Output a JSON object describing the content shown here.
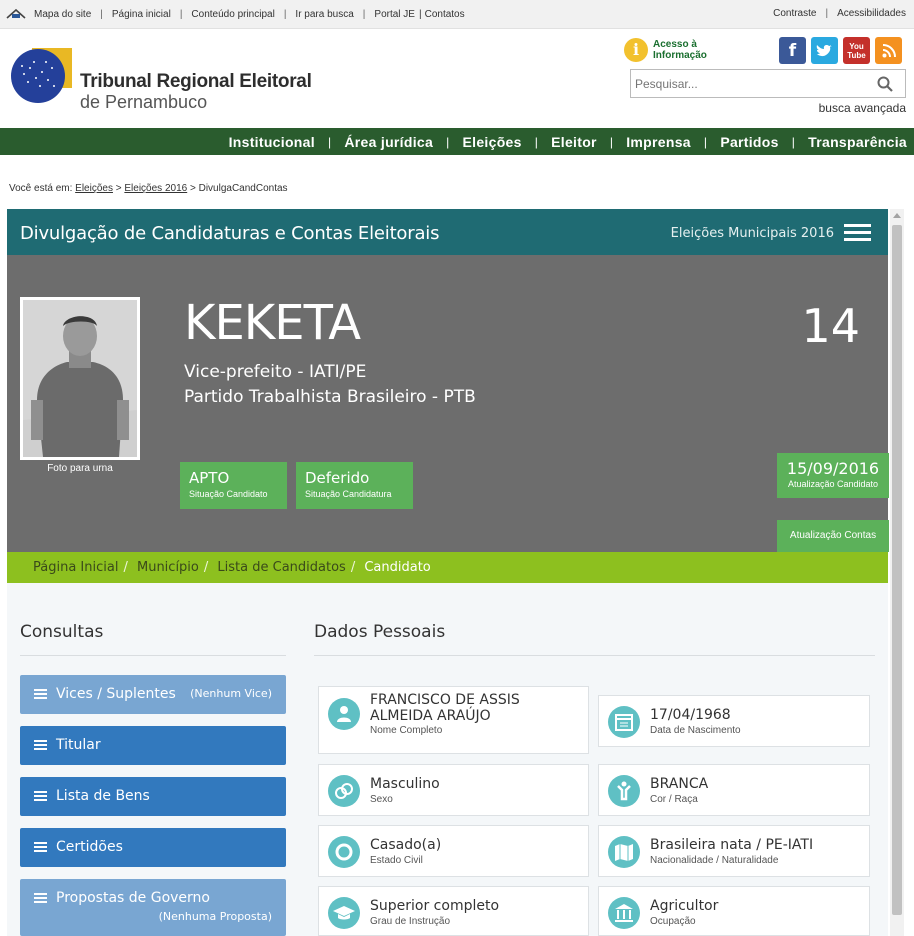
{
  "topbar": {
    "left_links": [
      "Mapa do site",
      "Página inicial",
      "Conteúdo principal",
      "Ir para busca",
      "Portal JE",
      "Contatos"
    ],
    "right_links": [
      "Contraste",
      "Acessibilidades"
    ]
  },
  "header": {
    "org_title": "Tribunal Regional Eleitoral",
    "org_subtitle": "de Pernambuco",
    "acesso_line1": "Acesso à",
    "acesso_line2": "Informação",
    "search_placeholder": "Pesquisar...",
    "advanced_search": "busca avançada",
    "social": [
      {
        "icon": "facebook-icon",
        "glyph": "f",
        "color": "#3b5998"
      },
      {
        "icon": "twitter-icon",
        "glyph": "t",
        "color": "#2aa9e0"
      },
      {
        "icon": "youtube-icon",
        "glyph": "You Tube",
        "color": "#c4302b"
      },
      {
        "icon": "rss-icon",
        "glyph": "rss",
        "color": "#f49120"
      }
    ]
  },
  "nav": {
    "items": [
      "Institucional",
      "Área jurídica",
      "Eleições",
      "Eleitor",
      "Imprensa",
      "Partidos",
      "Transparência"
    ]
  },
  "location": {
    "prefix": "Você está em:",
    "path": [
      "Eleições",
      "Eleições 2016"
    ],
    "current": "DivulgaCandContas"
  },
  "panel": {
    "title": "Divulgação de Candidaturas e Contas Eleitorais",
    "election": "Eleições Municipais 2016"
  },
  "candidate": {
    "name": "KEKETA",
    "number": "14",
    "role": "Vice-prefeito - IATI/PE",
    "party": "Partido Trabalhista Brasileiro - PTB",
    "photo_label": "Foto para urna",
    "status": {
      "value": "APTO",
      "label": "Situação Candidato"
    },
    "application": {
      "value": "Deferido",
      "label": "Situação Candidatura"
    },
    "update_date": {
      "value": "15/09/2016",
      "label": "Atualização Candidato"
    },
    "accounts_update": {
      "label": "Atualização Contas"
    }
  },
  "breadcrumb": [
    "Página Inicial",
    "Município",
    "Lista de Candidatos",
    "Candidato"
  ],
  "consultas": {
    "title": "Consultas",
    "buttons": [
      {
        "label": "Vices / Suplentes",
        "note": "(Nenhum Vice)",
        "style": "light"
      },
      {
        "label": "Titular",
        "note": "",
        "style": "dark"
      },
      {
        "label": "Lista de Bens",
        "note": "",
        "style": "dark"
      },
      {
        "label": "Certidões",
        "note": "",
        "style": "dark"
      },
      {
        "label": "Propostas de Governo",
        "note": "(Nenhuma Proposta)",
        "style": "light"
      }
    ]
  },
  "dados": {
    "title": "Dados Pessoais",
    "cards": [
      {
        "value": "FRANCISCO DE ASSIS ALMEIDA ARAÚJO",
        "label": "Nome Completo",
        "icon": "person-icon"
      },
      {
        "value": "17/04/1968",
        "label": "Data de Nascimento",
        "icon": "calendar-icon"
      },
      {
        "value": "Masculino",
        "label": "Sexo",
        "icon": "gender-icon"
      },
      {
        "value": "BRANCA",
        "label": "Cor / Raça",
        "icon": "person-raised-arms-icon"
      },
      {
        "value": "Casado(a)",
        "label": "Estado Civil",
        "icon": "ring-icon"
      },
      {
        "value": "Brasileira nata / PE-IATI",
        "label": "Nacionalidade / Naturalidade",
        "icon": "map-icon"
      },
      {
        "value": "Superior completo",
        "label": "Grau de Instrução",
        "icon": "graduation-cap-icon"
      },
      {
        "value": "Agricultor",
        "label": "Ocupação",
        "icon": "building-icon"
      }
    ]
  }
}
